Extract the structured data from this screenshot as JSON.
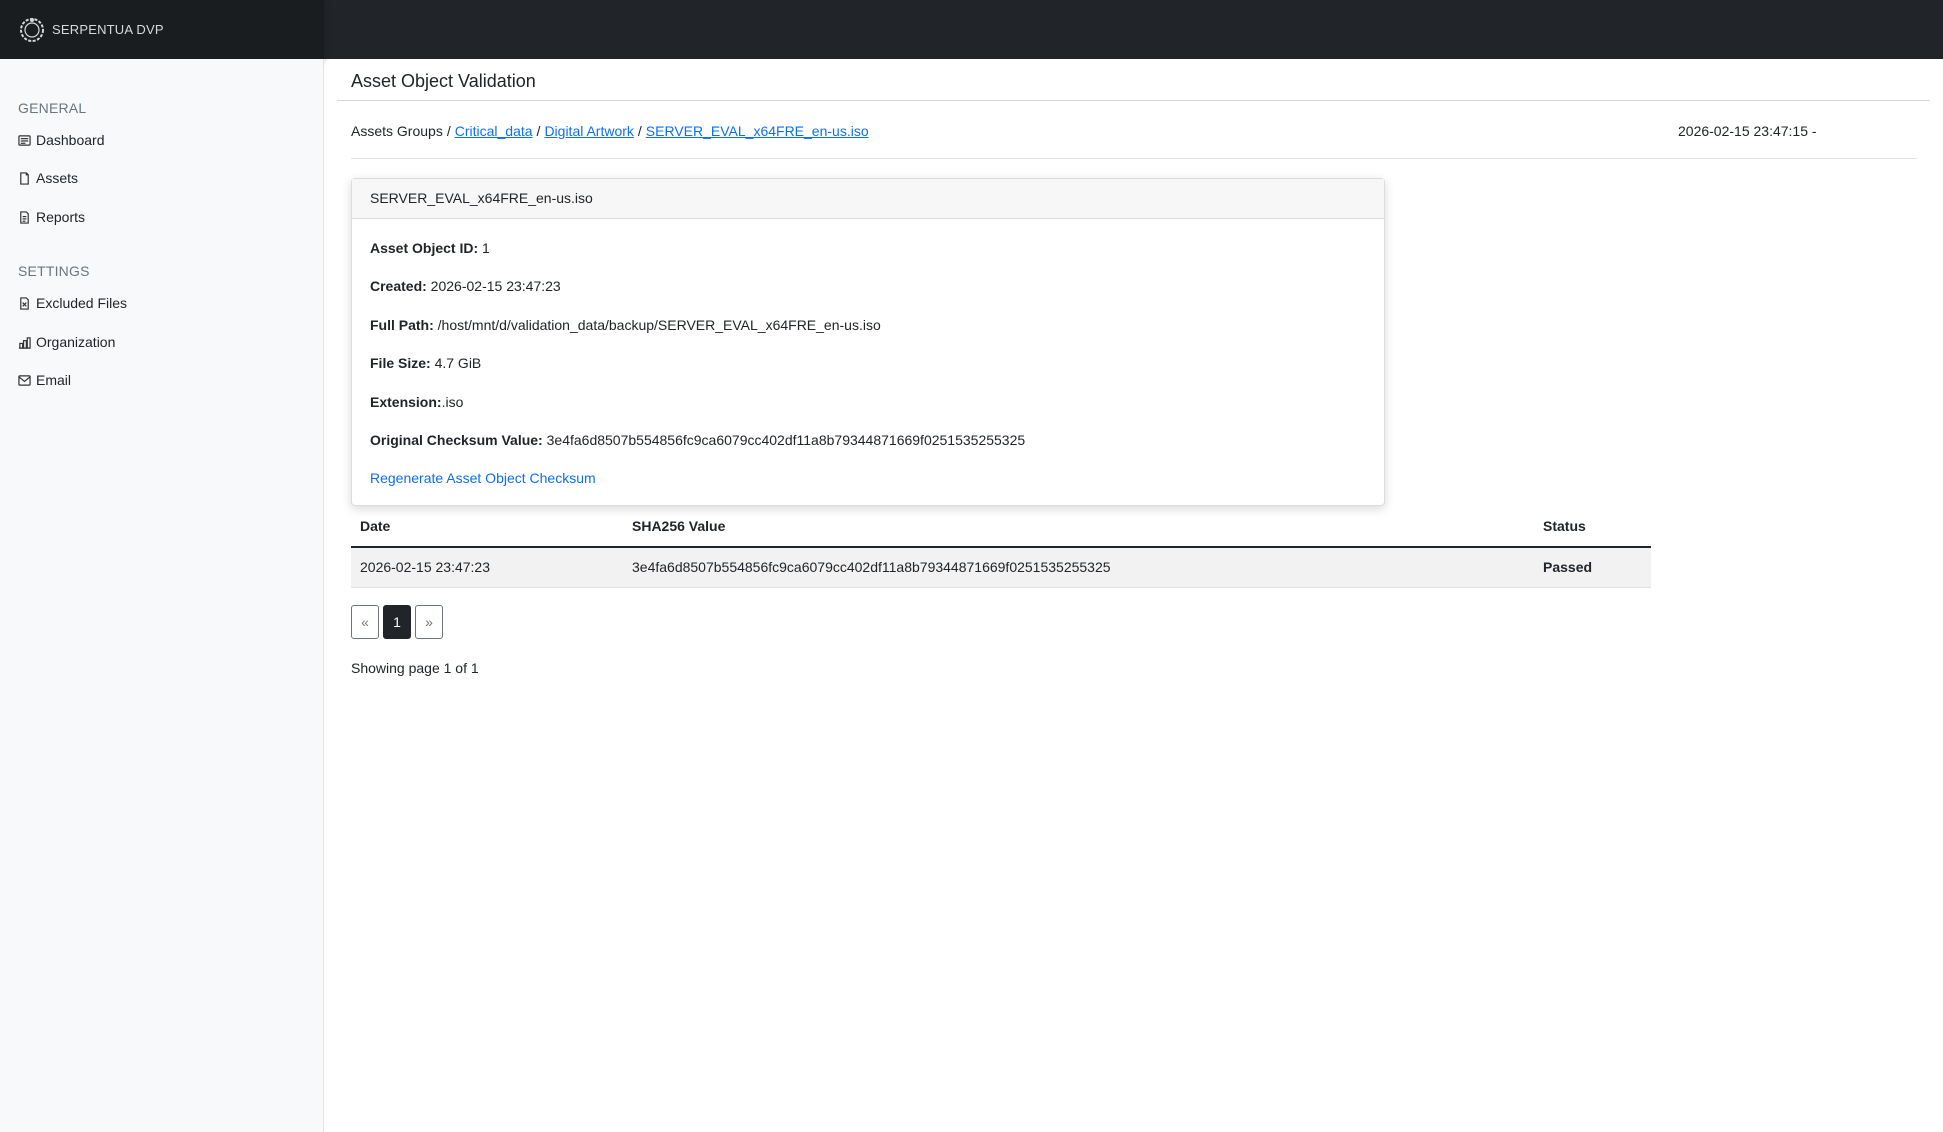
{
  "app": {
    "name": "SERPENTUA DVP"
  },
  "sidebar": {
    "general_heading": "GENERAL",
    "general_items": [
      {
        "label": "Dashboard",
        "icon": "dashboard-icon"
      },
      {
        "label": "Assets",
        "icon": "file-icon"
      },
      {
        "label": "Reports",
        "icon": "report-icon"
      }
    ],
    "settings_heading": "SETTINGS",
    "settings_items": [
      {
        "label": "Excluded Files",
        "icon": "excluded-file-icon"
      },
      {
        "label": "Organization",
        "icon": "organization-icon"
      },
      {
        "label": "Email",
        "icon": "email-icon"
      }
    ]
  },
  "page": {
    "title": "Asset Object Validation"
  },
  "breadcrumb": {
    "root": "Assets Groups",
    "separator": "/",
    "items": [
      "Critical_data ",
      "Digital Artwork",
      "SERVER_EVAL_x64FRE_en-us.iso"
    ]
  },
  "timestamp": "2026-02-15 23:47:15 -",
  "asset_card": {
    "header": "SERVER_EVAL_x64FRE_en-us.iso",
    "fields": [
      {
        "label": "Asset Object ID:",
        "value": " 1"
      },
      {
        "label": "Created:",
        "value": " 2026-02-15 23:47:23"
      },
      {
        "label": "Full Path:",
        "value": " /host/mnt/d/validation_data/backup/SERVER_EVAL_x64FRE_en-us.iso"
      },
      {
        "label": "File Size:",
        "value": " 4.7 GiB"
      },
      {
        "label": "Extension:",
        "value": ".iso"
      },
      {
        "label": "Original Checksum Value:",
        "value": " 3e4fa6d8507b554856fc9ca6079cc402df11a8b79344871669f0251535255325"
      }
    ],
    "action_link": "Regenerate Asset Object Checksum"
  },
  "table": {
    "columns": [
      "Date",
      "SHA256 Value",
      "Status"
    ],
    "rows": [
      [
        "2026-02-15 23:47:23",
        "3e4fa6d8507b554856fc9ca6079cc402df11a8b79344871669f0251535255325",
        "Passed"
      ]
    ]
  },
  "pagination": {
    "prev": "«",
    "current": "1",
    "next": "»",
    "summary": "Showing page 1 of 1"
  },
  "colors": {
    "topbar": "#212529",
    "link": "#0d6efd",
    "sidebar_bg": "#f8f9fa"
  }
}
